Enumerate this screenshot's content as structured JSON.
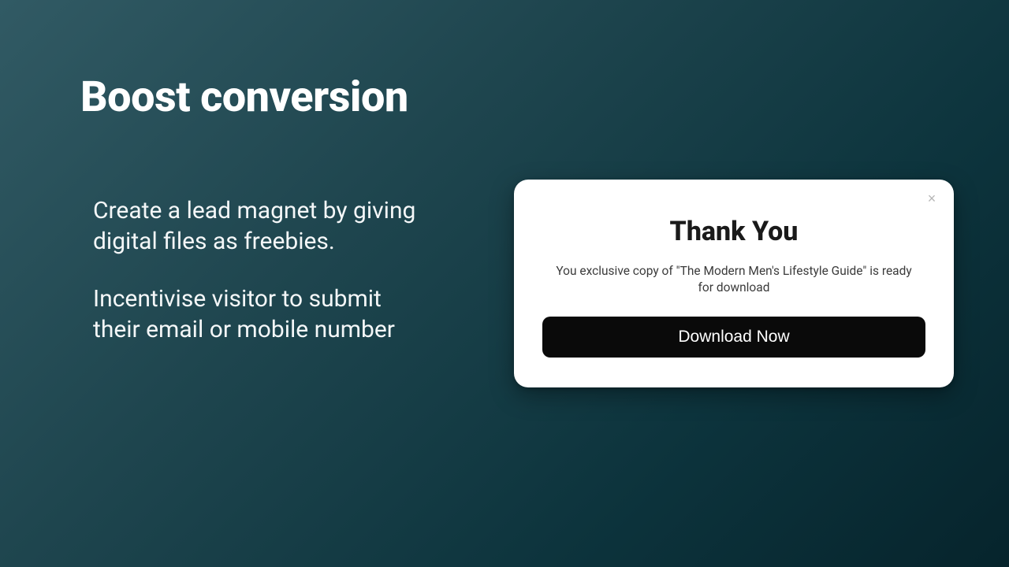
{
  "slide": {
    "title": "Boost conversion",
    "paragraph1": "Create a lead magnet by giving digital files as freebies.",
    "paragraph2": "Incentivise visitor to submit their email or mobile number"
  },
  "card": {
    "title": "Thank You",
    "subtitle": "You exclusive copy of \"The Modern Men's Lifestyle Guide\" is ready for download",
    "button_label": "Download Now",
    "close_label": "×"
  }
}
